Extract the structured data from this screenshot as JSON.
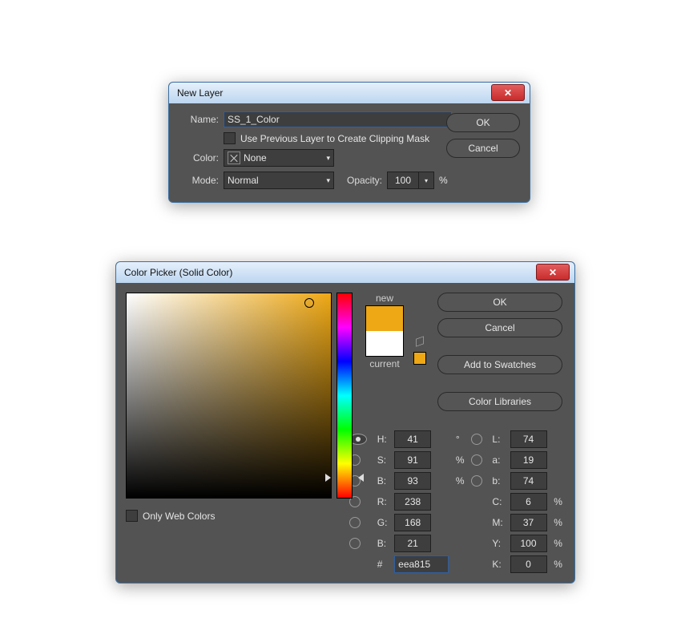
{
  "new_layer": {
    "title": "New Layer",
    "name_label": "Name:",
    "name_value": "SS_1_Color",
    "clipping_label": "Use Previous Layer to Create Clipping Mask",
    "clipping_checked": false,
    "color_label": "Color:",
    "color_value": "None",
    "mode_label": "Mode:",
    "mode_value": "Normal",
    "opacity_label": "Opacity:",
    "opacity_value": "100",
    "opacity_unit": "%",
    "ok_label": "OK",
    "cancel_label": "Cancel"
  },
  "color_picker": {
    "title": "Color Picker (Solid Color)",
    "new_label": "new",
    "current_label": "current",
    "only_web_label": "Only Web Colors",
    "only_web_checked": false,
    "ok_label": "OK",
    "cancel_label": "Cancel",
    "add_swatches_label": "Add to Swatches",
    "color_libraries_label": "Color Libraries",
    "hsb": {
      "H": "41",
      "S": "91",
      "B": "93"
    },
    "lab": {
      "L": "74",
      "a": "19",
      "b": "74"
    },
    "rgb": {
      "R": "238",
      "G": "168",
      "B": "21"
    },
    "cmyk": {
      "C": "6",
      "M": "37",
      "Y": "100",
      "K": "0"
    },
    "hex_label": "#",
    "hex_value": "eea815",
    "deg": "°",
    "pct": "%",
    "new_color": "#eea815",
    "current_color": "#ffffff",
    "selected_model": "H",
    "labels": {
      "H": "H:",
      "S": "S:",
      "B": "B:",
      "L": "L:",
      "a": "a:",
      "b": "b:",
      "R": "R:",
      "G": "G:",
      "Bl": "B:",
      "C": "C:",
      "M": "M:",
      "Y": "Y:",
      "K": "K:"
    }
  }
}
